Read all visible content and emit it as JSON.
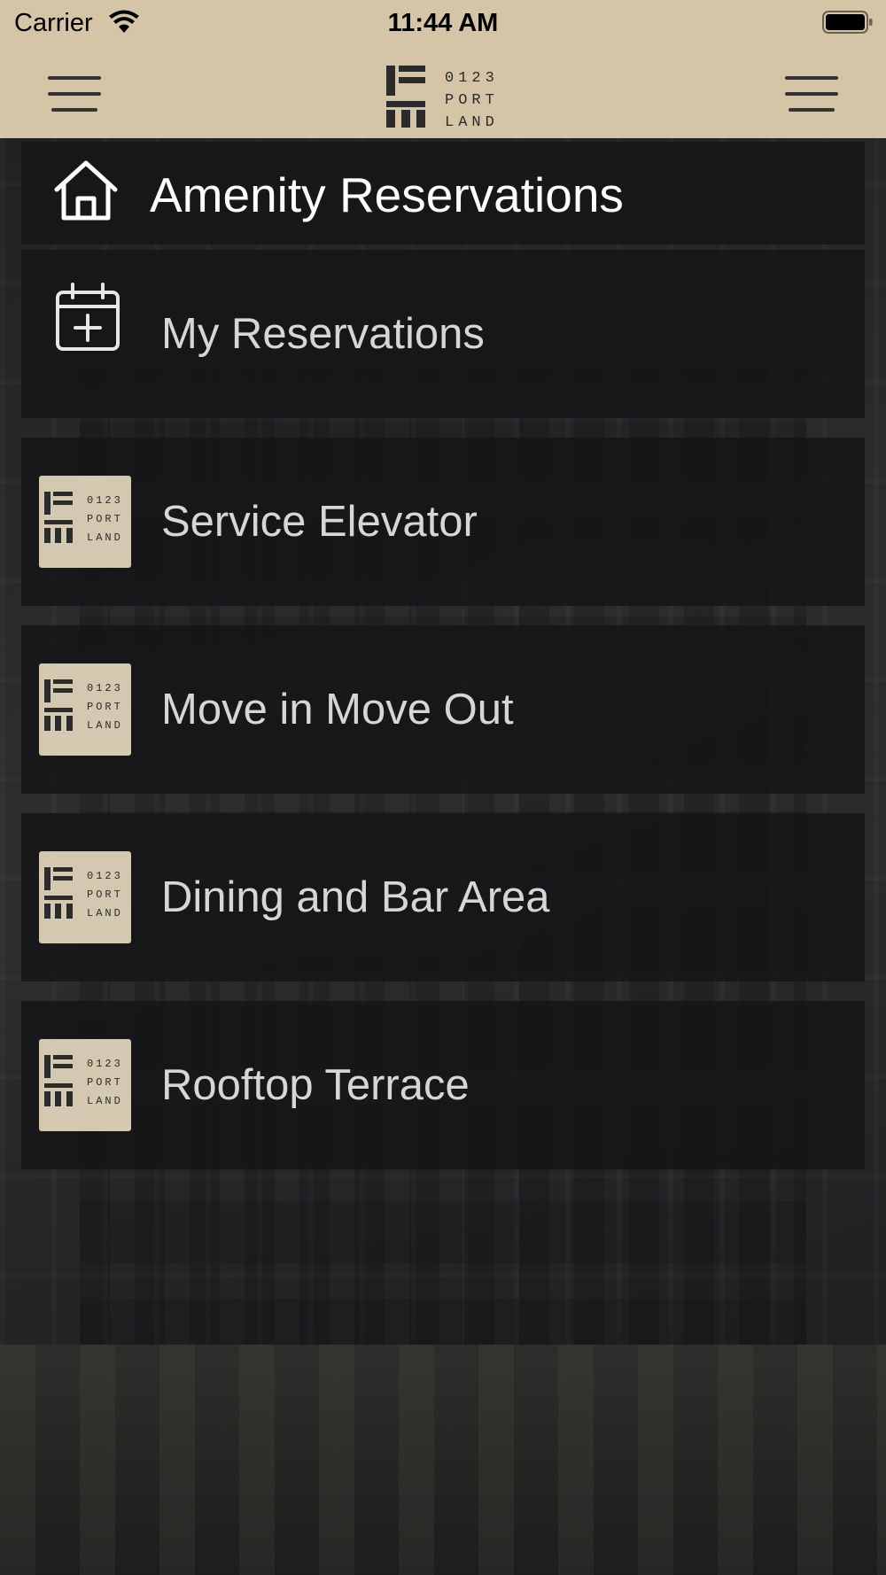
{
  "status_bar": {
    "carrier": "Carrier",
    "time": "11:44 AM",
    "wifi_icon": "wifi-icon",
    "battery_icon": "battery-full-icon"
  },
  "nav_bar": {
    "left_icon": "hamburger-menu-icon",
    "right_icon": "hamburger-menu-icon",
    "logo": {
      "line1": "0123",
      "line2": "PORT",
      "line3": "LAND"
    }
  },
  "page": {
    "title": "Amenity Reservations",
    "title_icon": "home-icon"
  },
  "menu_items": [
    {
      "label": "My Reservations",
      "icon": "calendar-plus-icon"
    },
    {
      "label": "Service Elevator",
      "icon": "portland-logo-thumbnail"
    },
    {
      "label": "Move in Move Out",
      "icon": "portland-logo-thumbnail"
    },
    {
      "label": "Dining and Bar Area",
      "icon": "portland-logo-thumbnail"
    },
    {
      "label": "Rooftop Terrace",
      "icon": "portland-logo-thumbnail"
    }
  ],
  "colors": {
    "nav_background": "#d3c5a5",
    "panel_background": "#161618",
    "title_text": "#ffffff",
    "item_text": "#d6d6d6",
    "logo_dark": "#2b2b2b"
  }
}
